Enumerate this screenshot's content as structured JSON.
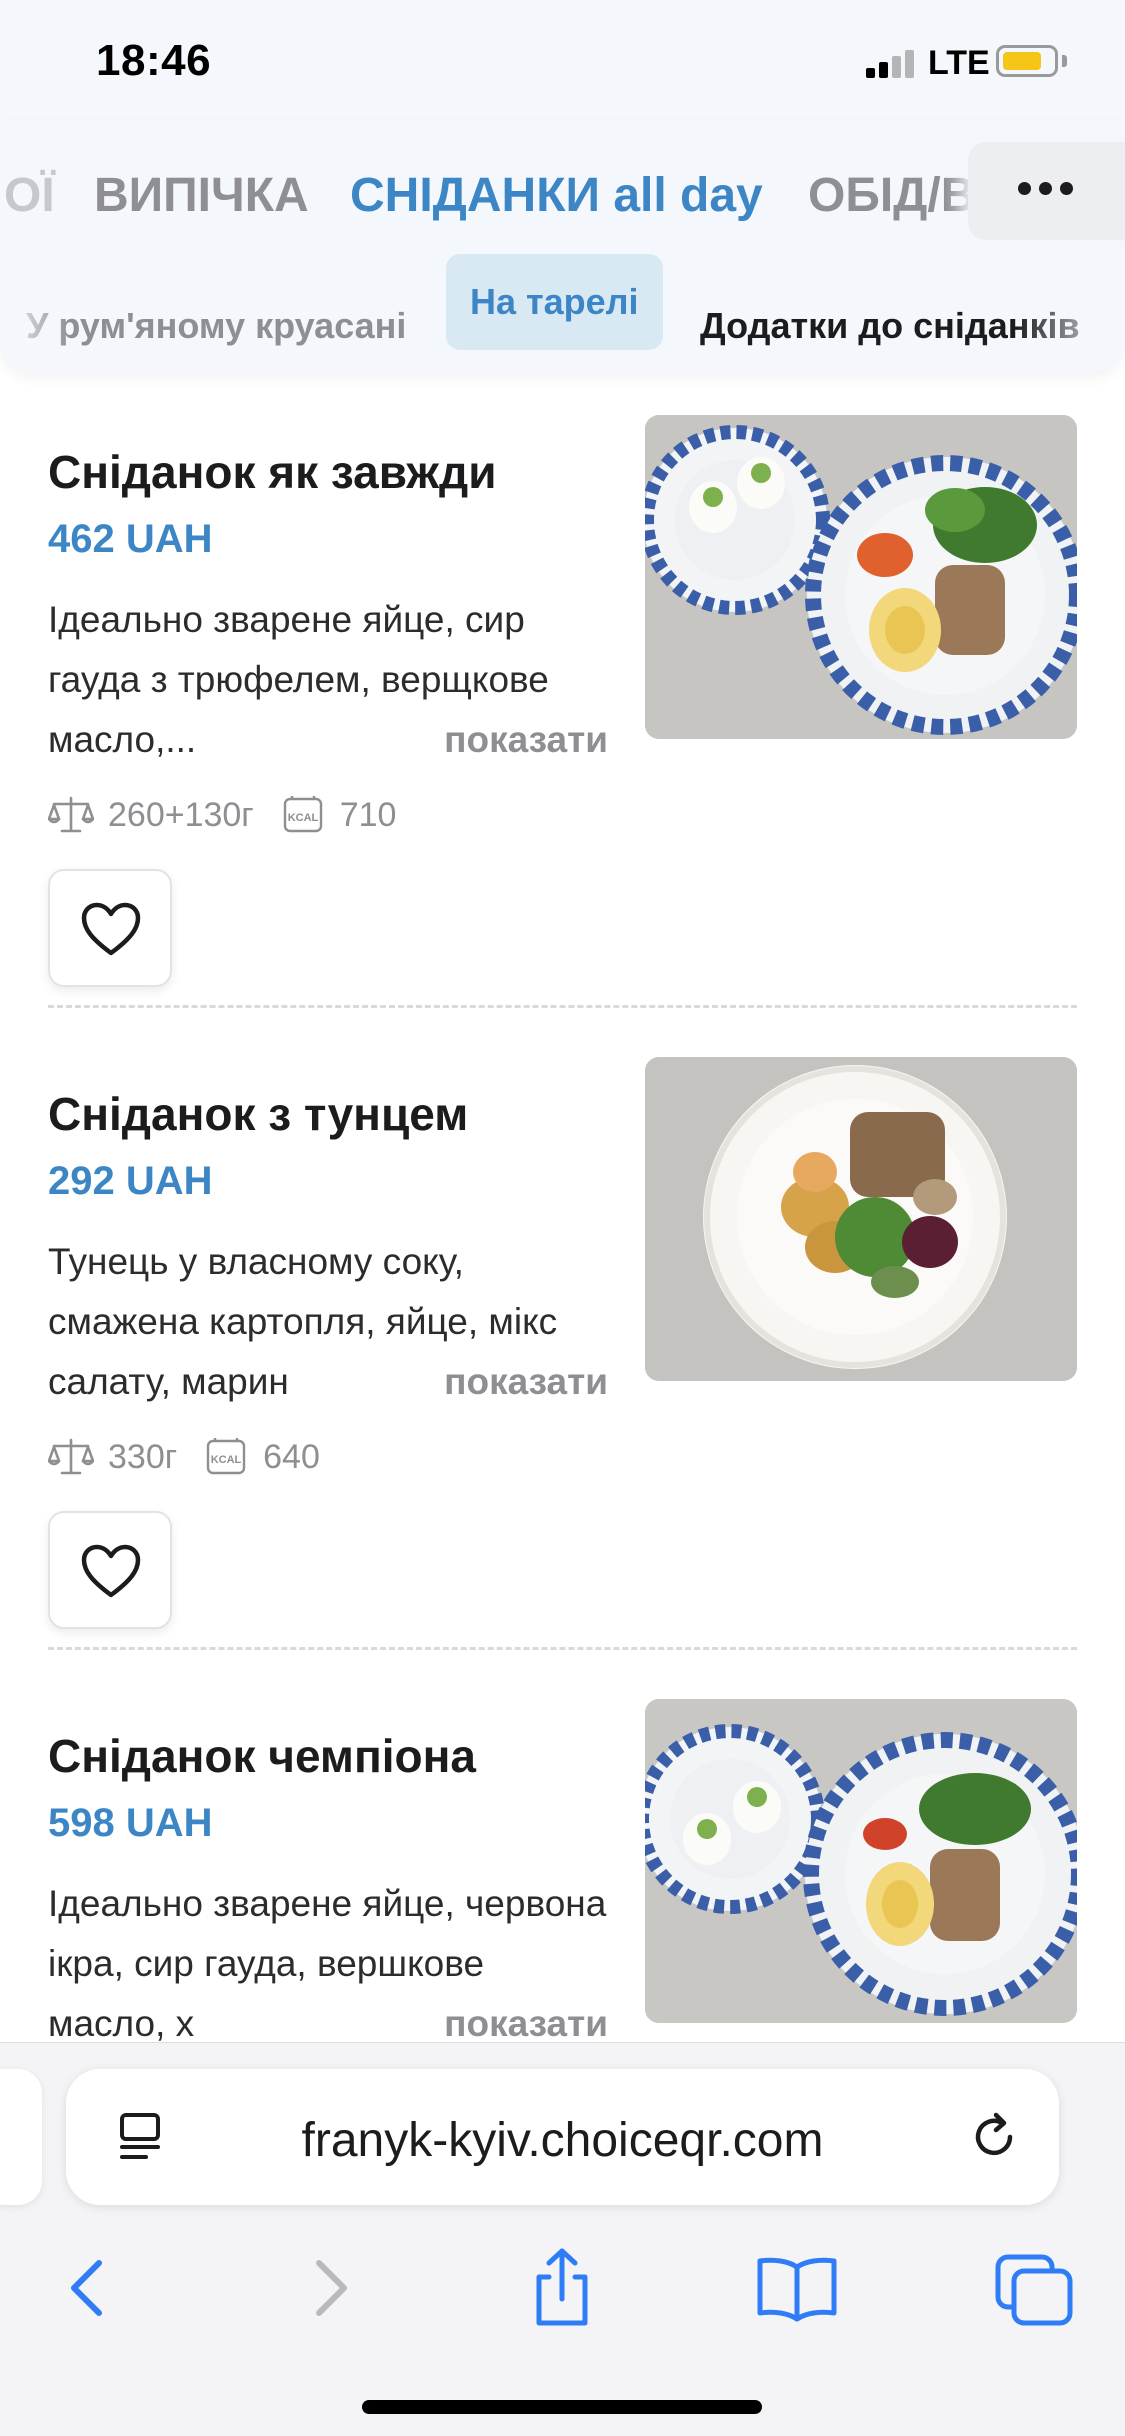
{
  "status_bar": {
    "time": "18:46",
    "network": "LTE"
  },
  "categories": [
    {
      "label": "ОЇ"
    },
    {
      "label": "ВИПІЧКА"
    },
    {
      "label": "СНІДАНКИ all day"
    },
    {
      "label": "ОБІД/В"
    }
  ],
  "subcategories": [
    {
      "label": "У рум'яному круасані"
    },
    {
      "label": "На тарелі"
    },
    {
      "label": "Додатки до сніданків"
    }
  ],
  "more_icon": "more-dots-icon",
  "items": [
    {
      "title": "Сніданок як завжди",
      "price": "462 UAH",
      "description": "Ідеально зварене яйце, сир гауда з трюфелем, верщкове масло,...",
      "show_more": "показати",
      "weight": "260+130г",
      "kcal": "710",
      "photo": "breakfast-two-plates-photo"
    },
    {
      "title": "Сніданок з тунцем",
      "price": "292 UAH",
      "description": "Тунець у власному соку, смажена картопля, яйце, мікс салату, марин",
      "show_more": "показати",
      "weight": "330г",
      "kcal": "640",
      "photo": "tuna-plate-photo"
    },
    {
      "title": "Сніданок чемпіона",
      "price": "598 UAH",
      "description": "Ідеально зварене яйце, червона ікра, сир гауда, вершкове масло, х",
      "show_more": "показати"
    }
  ],
  "browser": {
    "url": "franyk-kyiv.choiceqr.com"
  },
  "colors": {
    "accent": "#3d86c6",
    "accent_bg": "#d8e9f4",
    "muted": "#8e8e93",
    "battery": "#f5c518"
  }
}
